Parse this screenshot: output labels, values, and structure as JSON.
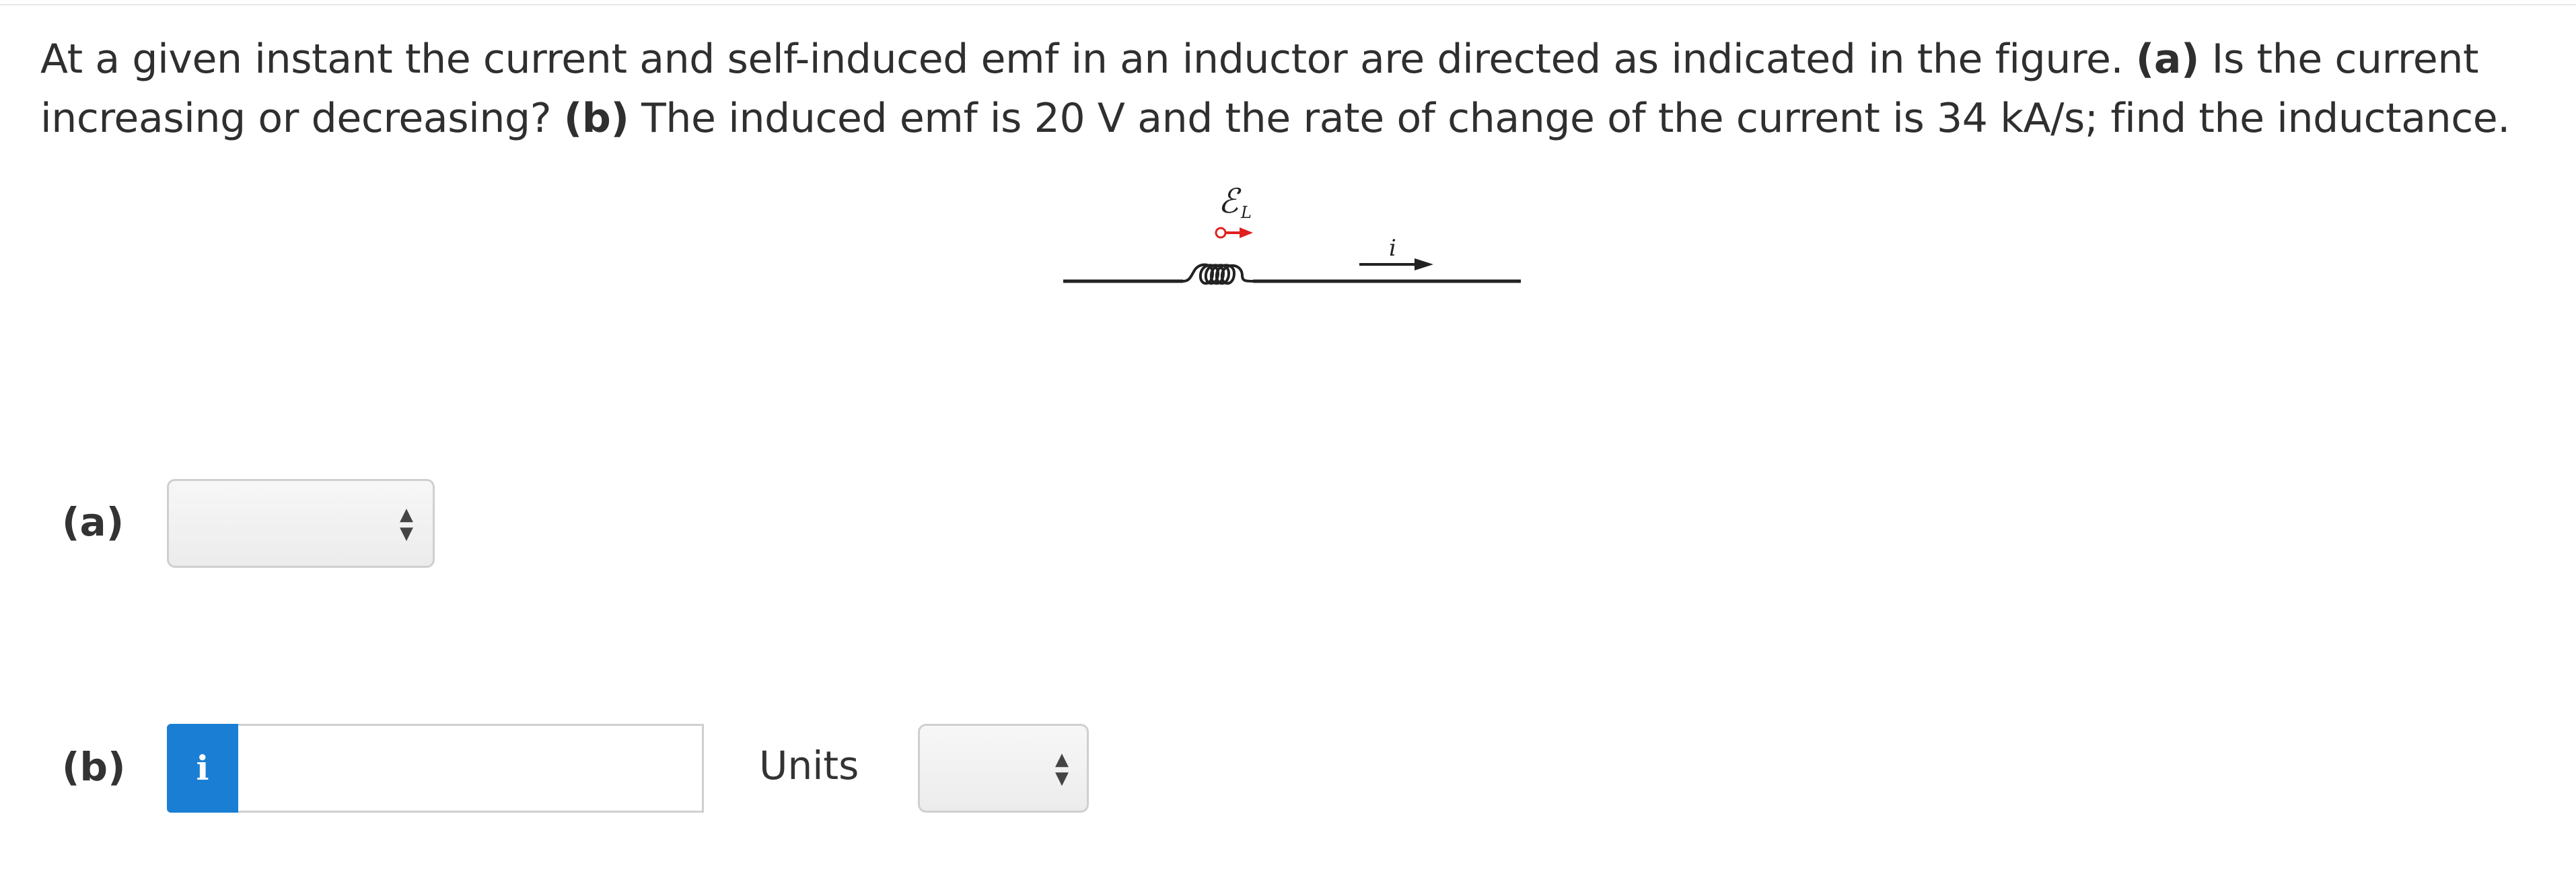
{
  "question": {
    "sentence_1": "At a given instant the current and self-induced emf in an inductor are directed as indicated in the figure.",
    "part_a_marker": "(a)",
    "part_a_text": "Is the current increasing or decreasing?",
    "part_b_marker": "(b)",
    "part_b_text": "The induced emf is 20 V and the rate of change of the current is 34 kA/s; find the inductance."
  },
  "figure": {
    "emf_symbol": "ℰ",
    "emf_subscript": "L",
    "current_symbol": "i",
    "arrow_color": "#e02020"
  },
  "answers": {
    "part_a": {
      "label": "(a)",
      "selected": ""
    },
    "part_b": {
      "label": "(b)",
      "info_icon": "i",
      "value": "",
      "units_label": "Units",
      "units_selected": ""
    }
  }
}
